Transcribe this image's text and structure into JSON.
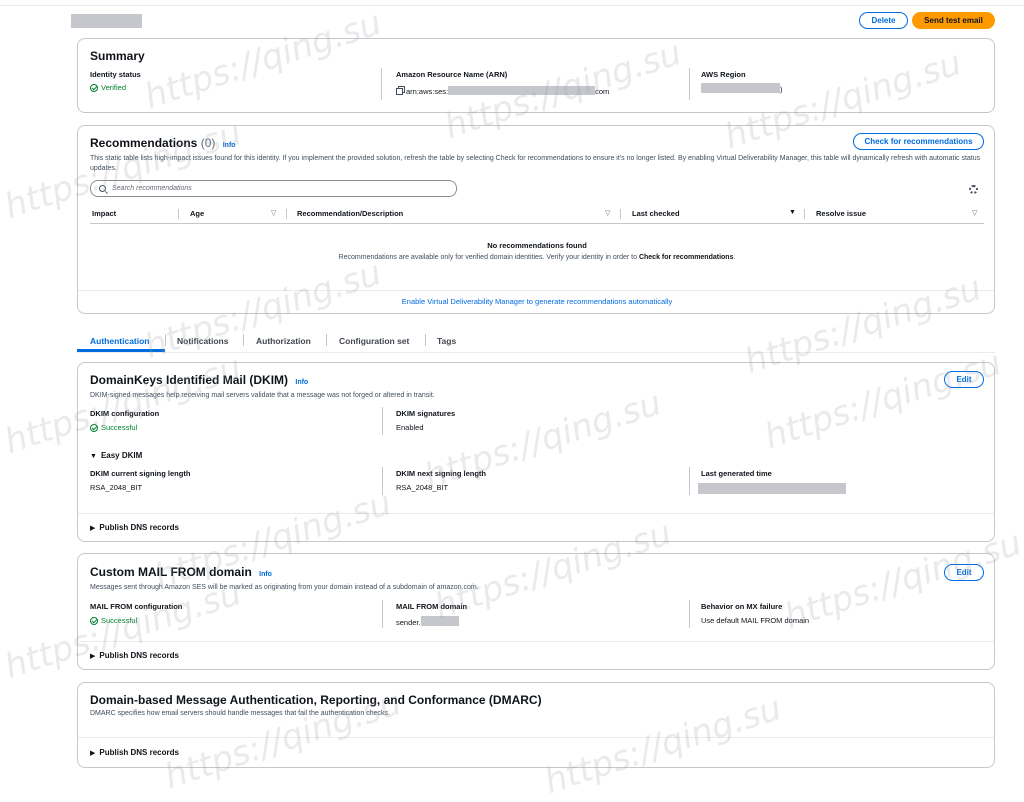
{
  "header": {
    "delete_label": "Delete",
    "send_test_label": "Send test email"
  },
  "summary": {
    "title": "Summary",
    "identity_status_label": "Identity status",
    "identity_status_value": "Verified",
    "arn_label": "Amazon Resource Name (ARN)",
    "arn_prefix": "arn:aws:ses:",
    "arn_suffix": "com",
    "region_label": "AWS Region",
    "region_suffix": ")"
  },
  "recommendations": {
    "title": "Recommendations",
    "count": "(0)",
    "info": "Info",
    "check_button": "Check for recommendations",
    "description": "This static table lists high-impact issues found for this identity. If you implement the provided solution, refresh the table by selecting Check for recommendations to ensure it's no longer listed. By enabling Virtual Deliverability Manager, this table will dynamically refresh with automatic status updates.",
    "search_placeholder": "Search recommendations",
    "columns": [
      "Impact",
      "Age",
      "Recommendation/Description",
      "Last checked",
      "Resolve issue"
    ],
    "empty_title": "No recommendations found",
    "empty_text": "Recommendations are available only for verified domain identities. Verify your identity in order to",
    "empty_link": "Check for recommendations",
    "empty_period": ".",
    "vdm_link": "Enable Virtual Deliverability Manager to generate recommendations automatically"
  },
  "tabs": [
    "Authentication",
    "Notifications",
    "Authorization",
    "Configuration set",
    "Tags"
  ],
  "dkim": {
    "title": "DomainKeys Identified Mail (DKIM)",
    "info": "Info",
    "edit": "Edit",
    "description": "DKIM-signed messages help receiving mail servers validate that a message was not forged or altered in transit.",
    "config_label": "DKIM configuration",
    "config_value": "Successful",
    "signatures_label": "DKIM signatures",
    "signatures_value": "Enabled",
    "easy_dkim": "Easy DKIM",
    "current_len_label": "DKIM current signing length",
    "current_len_value": "RSA_2048_BIT",
    "next_len_label": "DKIM next signing length",
    "next_len_value": "RSA_2048_BIT",
    "last_generated_label": "Last generated time",
    "publish_dns": "Publish DNS records"
  },
  "mail_from": {
    "title": "Custom MAIL FROM domain",
    "info": "Info",
    "edit": "Edit",
    "description": "Messages sent through Amazon SES will be marked as originating from your domain instead of a subdomain of amazon.com.",
    "config_label": "MAIL FROM configuration",
    "config_value": "Successful",
    "domain_label": "MAIL FROM domain",
    "domain_prefix": "sender.",
    "mx_label": "Behavior on MX failure",
    "mx_value": "Use default MAIL FROM domain",
    "publish_dns": "Publish DNS records"
  },
  "dmarc": {
    "title": "Domain-based Message Authentication, Reporting, and Conformance (DMARC)",
    "description": "DMARC specifies how email servers should handle messages that fail the authentication checks.",
    "publish_dns": "Publish DNS records"
  },
  "watermark": "https://qing.su",
  "colors": {
    "link": "#006ce0",
    "primary": "#ff9900",
    "success": "#00802f",
    "border": "#c6c6cd"
  }
}
